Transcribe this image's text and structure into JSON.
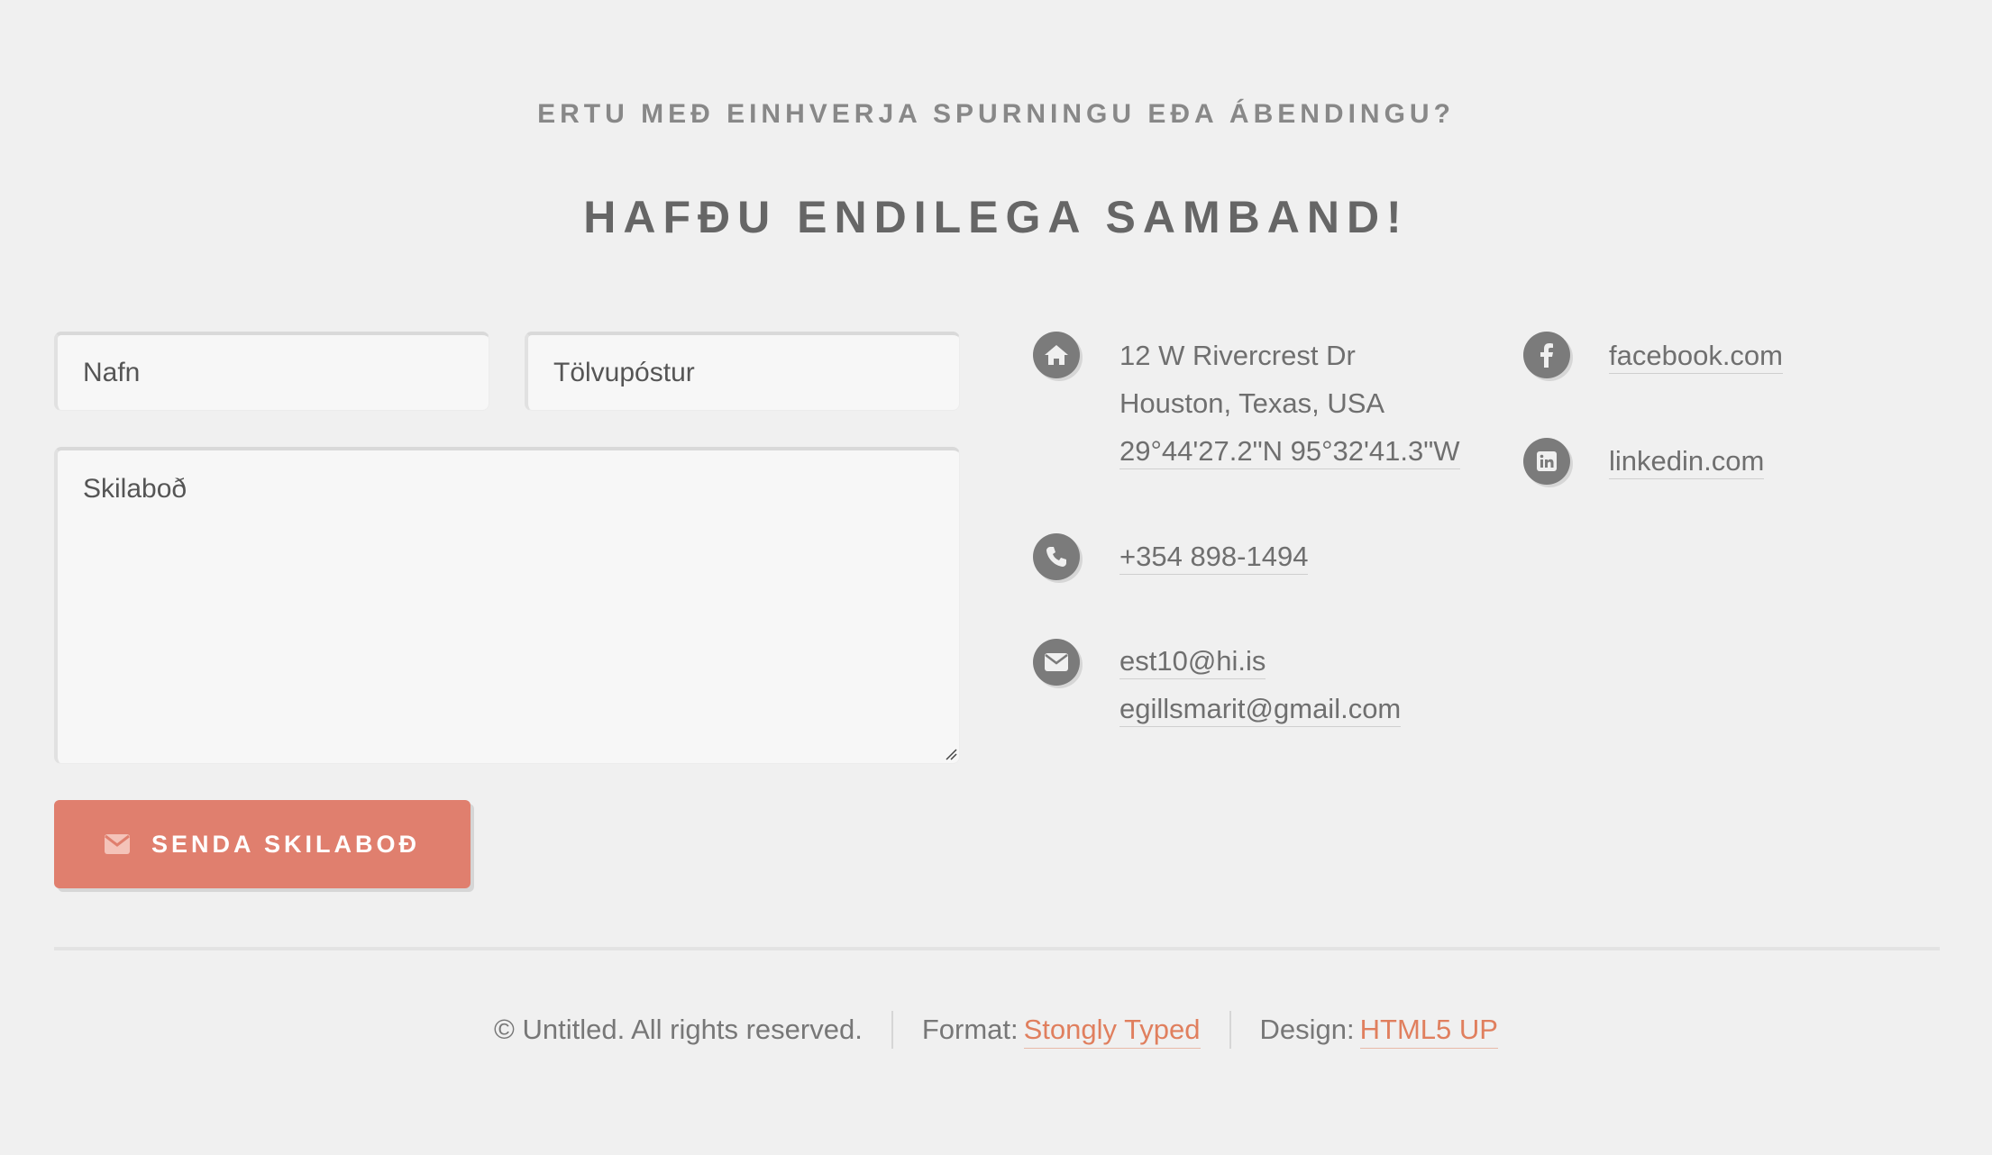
{
  "header": {
    "subtitle": "ERTU MEÐ EINHVERJA SPURNINGU EÐA ÁBENDINGU?",
    "title": "HAFÐU ENDILEGA SAMBAND!"
  },
  "form": {
    "name_placeholder": "Nafn",
    "email_placeholder": "Tölvupóstur",
    "message_placeholder": "Skilaboð",
    "send_label": "SENDA SKILABOÐ",
    "send_icon": "envelope-icon"
  },
  "contact": {
    "address_line1": "12 W Rivercrest Dr",
    "address_line2": "Houston, Texas, USA",
    "coordinates": "29°44'27.2\"N 95°32'41.3\"W",
    "phone": "+354 898-1494",
    "email1": "est10@hi.is",
    "email2": "egillsmarit@gmail.com",
    "icons": [
      "home-icon",
      "phone-icon",
      "envelope-icon"
    ]
  },
  "social": {
    "facebook": "facebook.com",
    "linkedin": "linkedin.com",
    "icons": [
      "facebook-icon",
      "linkedin-icon"
    ]
  },
  "footer": {
    "copyright": "© Untitled. All rights reserved.",
    "format_label": "Format:",
    "format_link": "Stongly Typed",
    "design_label": "Design:",
    "design_link": "HTML5 UP"
  },
  "colors": {
    "background": "#f0f0f0",
    "accent": "#e07f6e",
    "link_accent": "#e07f5e",
    "icon_circle": "#7b7b7b"
  }
}
